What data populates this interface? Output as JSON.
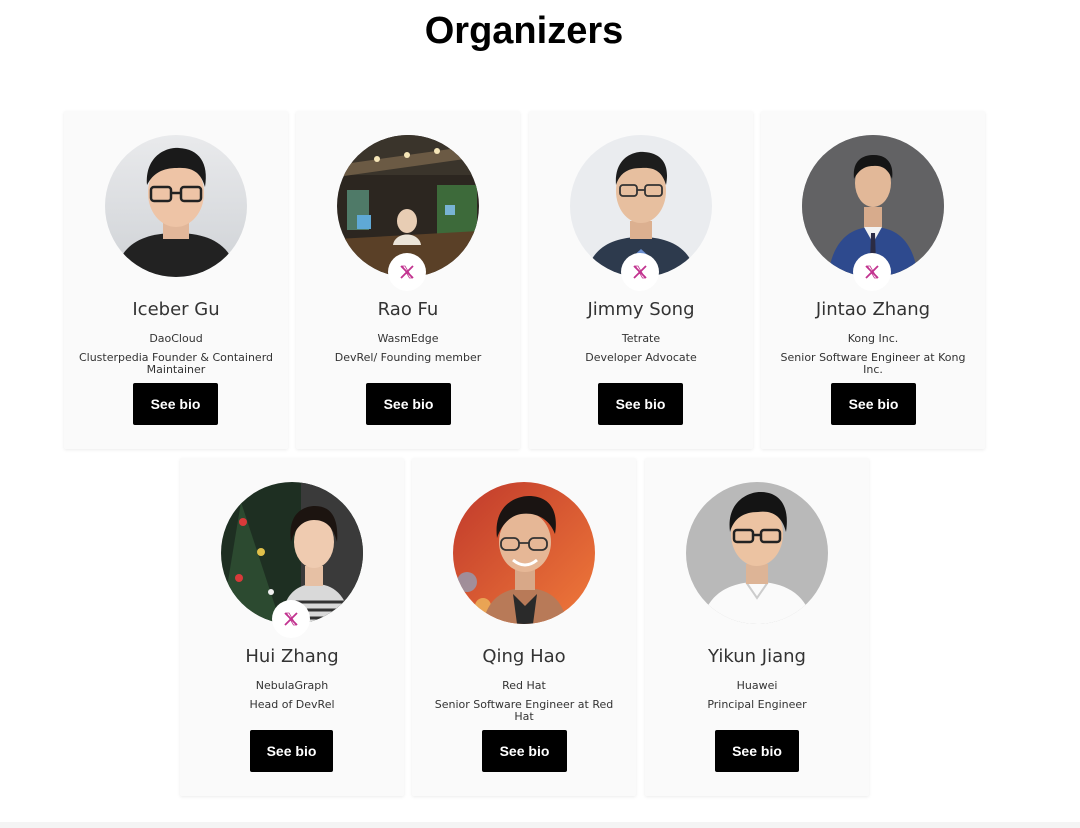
{
  "page": {
    "title": "Organizers"
  },
  "organizers": [
    {
      "name": "Iceber Gu",
      "company": "DaoCloud",
      "role": "Clusterpedia Founder & Containerd Maintainer",
      "bio_label": "See bio",
      "has_x": false
    },
    {
      "name": "Rao Fu",
      "company": "WasmEdge",
      "role": "DevRel/ Founding member",
      "bio_label": "See bio",
      "has_x": true
    },
    {
      "name": "Jimmy Song",
      "company": "Tetrate",
      "role": "Developer Advocate",
      "bio_label": "See bio",
      "has_x": true
    },
    {
      "name": "Jintao Zhang",
      "company": "Kong Inc.",
      "role": "Senior Software Engineer at Kong Inc.",
      "bio_label": "See bio",
      "has_x": true
    },
    {
      "name": "Hui Zhang",
      "company": "NebulaGraph",
      "role": "Head of DevRel",
      "bio_label": "See bio",
      "has_x": true
    },
    {
      "name": "Qing Hao",
      "company": "Red Hat",
      "role": "Senior Software Engineer at Red Hat",
      "bio_label": "See bio",
      "has_x": false
    },
    {
      "name": "Yikun Jiang",
      "company": "Huawei",
      "role": "Principal Engineer",
      "bio_label": "See bio",
      "has_x": false
    }
  ],
  "colors": {
    "x_icon": "#c2338f",
    "button_bg": "#000000",
    "card_bg": "#fafafa"
  }
}
